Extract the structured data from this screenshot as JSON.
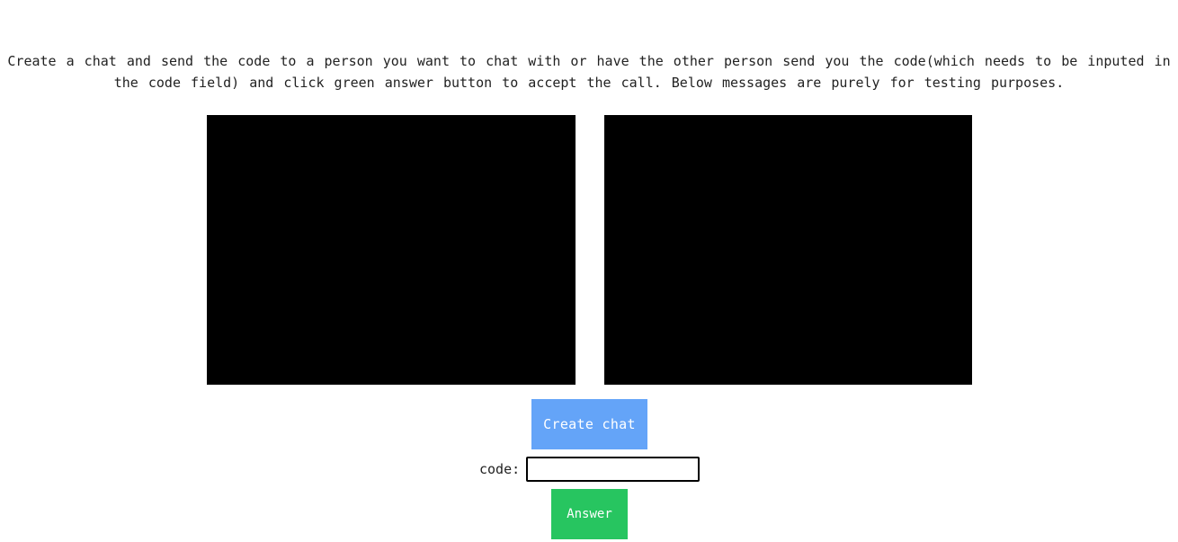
{
  "instructions": "Create a chat and send the code to a person you want to chat with or have the other person send you the code(which needs to be inputed in the code field) and click green answer button to accept the call. Below messages are purely for testing purposes.",
  "buttons": {
    "create_chat": "Create chat",
    "answer": "Answer"
  },
  "code": {
    "label": "code:",
    "value": ""
  },
  "colors": {
    "create_chat_bg": "#64a4f8",
    "answer_bg": "#27c560",
    "video_bg": "#000000"
  }
}
